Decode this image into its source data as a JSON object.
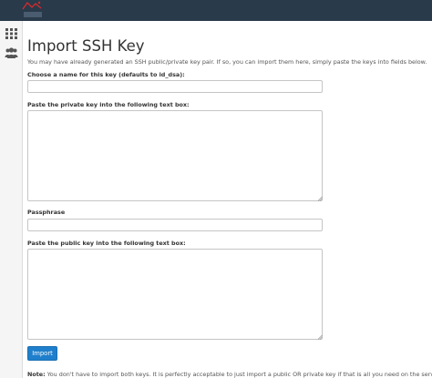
{
  "page": {
    "title": "Import SSH Key",
    "intro": "You may have already generated an SSH public/private key pair. If so, you can import them here, simply paste the keys into fields below."
  },
  "form": {
    "name_label": "Choose a name for this key (defaults to id_dsa):",
    "name_value": "",
    "private_key_label": "Paste the private key into the following text box:",
    "private_key_value": "",
    "passphrase_label": "Passphrase",
    "passphrase_value": "",
    "public_key_label": "Paste the public key into the following text box:",
    "public_key_value": "",
    "import_button": "Import"
  },
  "note": {
    "prefix": "Note:",
    "text": " You don't have to import both keys. It is perfectly acceptable to just import a public OR private key if that is all you need on the server."
  },
  "sidebar": {
    "items": [
      {
        "icon": "grid-icon"
      },
      {
        "icon": "users-icon"
      }
    ]
  },
  "colors": {
    "topbar": "#293a4a",
    "button": "#1f7fcc"
  }
}
